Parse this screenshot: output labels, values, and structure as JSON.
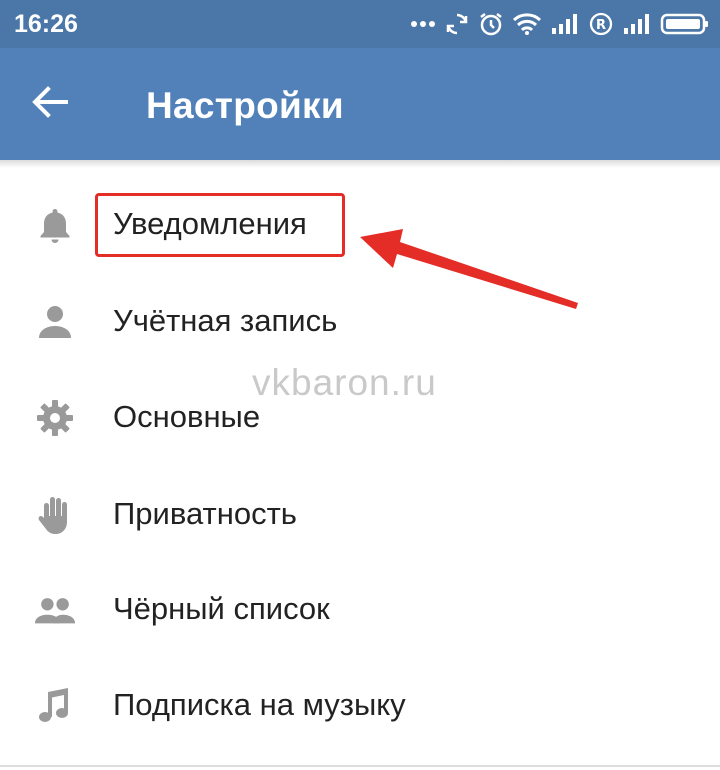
{
  "status_bar": {
    "time": "16:26",
    "icons": [
      "more-dots-icon",
      "sync-icon",
      "alarm-icon",
      "wifi-icon",
      "signal-icon",
      "roaming-icon",
      "signal-icon",
      "battery-icon"
    ]
  },
  "app_bar": {
    "title": "Настройки",
    "back_icon": "arrow-left-icon"
  },
  "menu": {
    "items": [
      {
        "label": "Уведомления",
        "icon": "bell-icon"
      },
      {
        "label": "Учётная запись",
        "icon": "person-icon"
      },
      {
        "label": "Основные",
        "icon": "gear-icon"
      },
      {
        "label": "Приватность",
        "icon": "hand-icon"
      },
      {
        "label": "Чёрный список",
        "icon": "people-icon"
      },
      {
        "label": "Подписка на музыку",
        "icon": "music-note-icon"
      }
    ]
  },
  "watermark": "vkbaron.ru",
  "colors": {
    "status_bar": "#4a76a8",
    "app_bar": "#5181b8",
    "icon_gray": "#9a9a9a",
    "highlight_red": "#e52d27"
  }
}
